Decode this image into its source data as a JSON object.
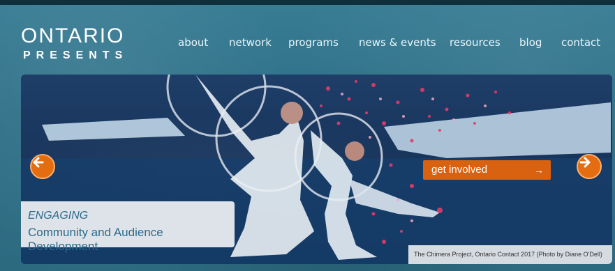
{
  "header": {
    "logo_top": "ONTARIO",
    "logo_bottom": "PRESENTS"
  },
  "nav": {
    "items": [
      {
        "label": "about"
      },
      {
        "label": "network"
      },
      {
        "label": "programs"
      },
      {
        "label": "news & events"
      },
      {
        "label": "resources"
      },
      {
        "label": "blog"
      },
      {
        "label": "contact"
      }
    ]
  },
  "hero": {
    "cta_label": "get involved",
    "cta_arrow": "→",
    "kicker": "ENGAGING",
    "title": "Community and Audience Development",
    "photo_credit": "The Chimera Project, Ontario Contact 2017 (Photo by Diane O'Dell)"
  },
  "colors": {
    "background": "#2f6f86",
    "accent_orange": "#d96211",
    "caption_text": "#2a6b8b"
  },
  "icons": {
    "prev": "arrow-left-icon",
    "next": "arrow-right-icon"
  }
}
